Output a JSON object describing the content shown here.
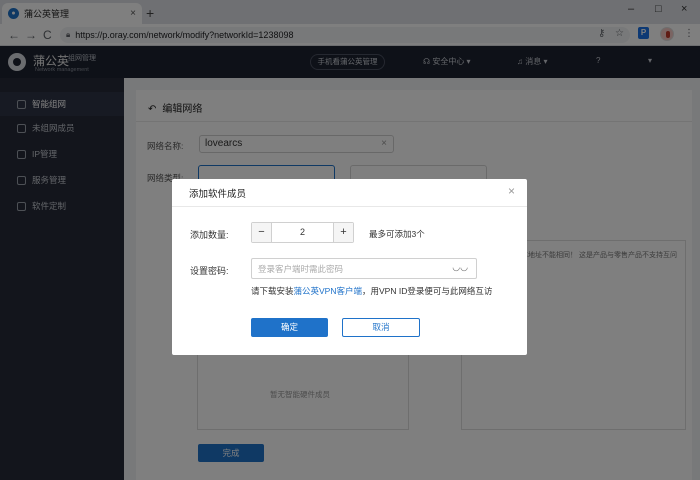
{
  "browser": {
    "tab_title": "蒲公英管理",
    "tab_close": "×",
    "new_tab": "+",
    "win_min": "–",
    "win_max": "□",
    "win_close": "×",
    "back": "←",
    "forward": "→",
    "reload": "C",
    "url": "https://p.oray.com/network/modify?networkId=1238098",
    "ext_label": "P"
  },
  "header": {
    "logo_text": "蒲公英",
    "logo_sub": "组网管理",
    "logo_en": "Network management",
    "mobile_btn": "手机看蒲公英管理",
    "account": "安全中心 ▾",
    "messages": "消息 ▾",
    "help": "?",
    "flag": "▾"
  },
  "sidebar": {
    "items": [
      {
        "label": "智能组网"
      },
      {
        "label": "未组网成员"
      },
      {
        "label": "IP管理"
      },
      {
        "label": "服务管理"
      },
      {
        "label": "软件定制"
      }
    ]
  },
  "main": {
    "back_icon": "↶",
    "title": "编辑网络",
    "name_label": "网络名称:",
    "network_name": "lovearcs",
    "clear": "×",
    "type_label": "网络类型:",
    "empty_members": "暂无智能硬件成员",
    "side_note": "本地址不能相同！ 这是产品与零售产品不支持互问",
    "done": "完成"
  },
  "modal": {
    "title": "添加软件成员",
    "close": "×",
    "count_label": "添加数量:",
    "minus": "−",
    "count_value": "2",
    "plus": "+",
    "count_hint": "最多可添加3个",
    "pwd_label": "设置密码:",
    "pwd_placeholder": "登录客户端时需此密码",
    "tip_prefix": "请下载安装",
    "tip_link": "蒲公英VPN客户端",
    "tip_suffix": "，用VPN ID登录便可与此网络互访",
    "confirm": "确定",
    "cancel": "取消"
  },
  "colors": {
    "primary": "#1f72c9",
    "header_bg": "#1d2230",
    "sidebar_bg": "#262b38"
  }
}
